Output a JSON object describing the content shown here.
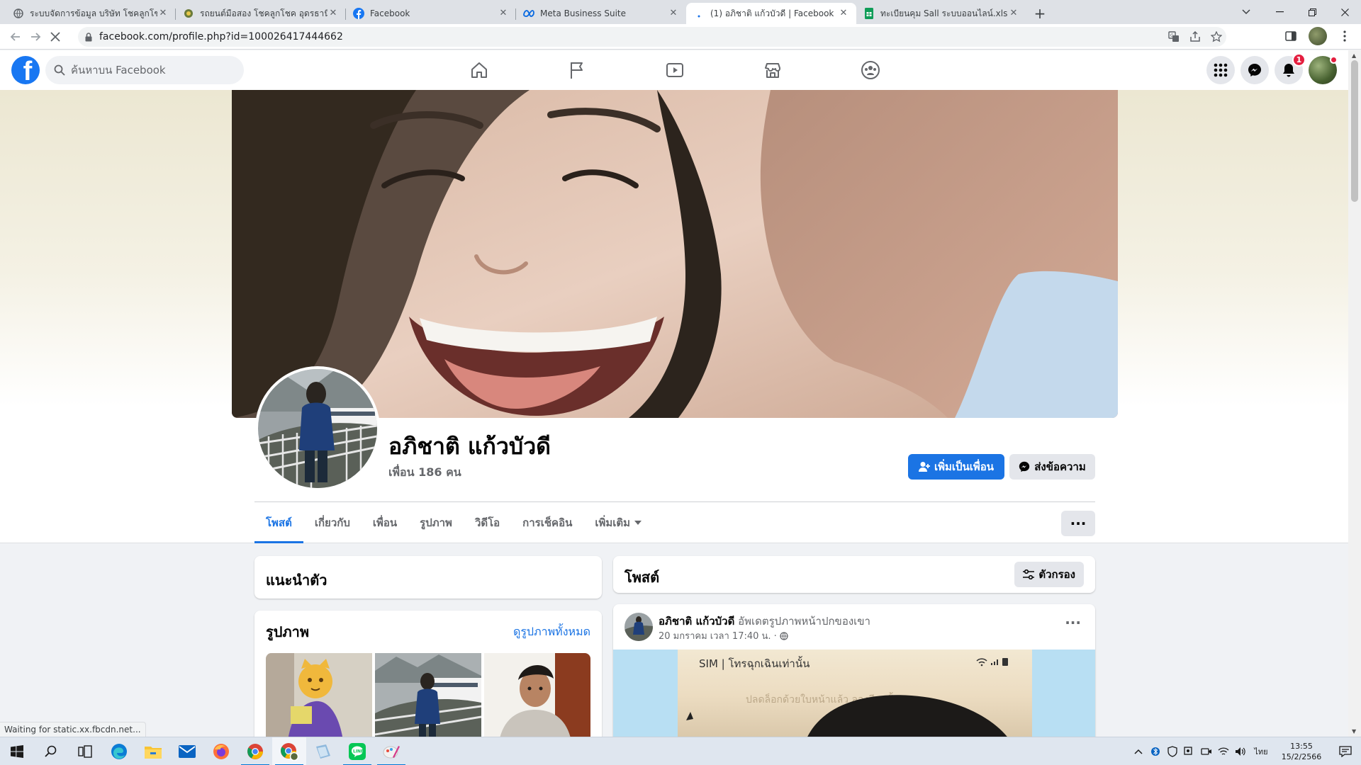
{
  "browser": {
    "tabs": [
      {
        "title": "ระบบจัดการข้อมูล บริษัท โชคลูกโชค จำกัด",
        "icon": "globe"
      },
      {
        "title": "รถยนต์มือสอง โชคลูกโชค อุดรธานี",
        "icon": "site"
      },
      {
        "title": "Facebook",
        "icon": "facebook"
      },
      {
        "title": "Meta Business Suite",
        "icon": "meta"
      },
      {
        "title": "(1) อภิชาติ แก้วบัวดี | Facebook",
        "icon": "loading",
        "active": true
      },
      {
        "title": "ทะเบียนคุม Sall ระบบออนไลน์.xlsx - Google ชีต",
        "icon": "sheets"
      }
    ],
    "new_tab": "+",
    "url": "facebook.com/profile.php?id=100026417444662"
  },
  "facebook": {
    "search_placeholder": "ค้นหาบน Facebook",
    "notification_count": "1",
    "nav_icons": [
      "home-icon",
      "pages-flag-icon",
      "watch-video-icon",
      "marketplace-icon",
      "groups-icon"
    ]
  },
  "profile": {
    "name": "อภิชาติ แก้วบัวดี",
    "friends": "เพื่อน 186 คน",
    "add_friend": "เพิ่มเป็นเพื่อน",
    "message": "ส่งข้อความ",
    "tabs": [
      "โพสต์",
      "เกี่ยวกับ",
      "เพื่อน",
      "รูปภาพ",
      "วิดีโอ",
      "การเช็คอิน",
      "เพิ่มเติม"
    ],
    "more_dots": "···"
  },
  "intro": {
    "title": "แนะนำตัว"
  },
  "photos": {
    "title": "รูปภาพ",
    "see_all": "ดูรูปภาพทั้งหมด"
  },
  "posts": {
    "title": "โพสต์",
    "filter": "ตัวกรอง"
  },
  "post": {
    "author": "อภิชาติ แก้วบัวดี",
    "action": "อัพเดตรูปภาพหน้าปกของเขา",
    "time": "20 มกราคม เวลา 17:40 น. ·",
    "dots": "···",
    "screen_text": "SIM | โทรฉุกเฉินเท่านั้น",
    "screen_sub": "ปลดล็อกด้วยใบหน้าแล้ว ลองอีกครั้ง"
  },
  "status": {
    "text": "Waiting for static.xx.fbcdn.net..."
  },
  "taskbar": {
    "time": "13:55",
    "date": "15/2/2566",
    "lang": "ไทย"
  },
  "colors": {
    "fb_blue": "#1877f2",
    "button_blue": "#1b74e4",
    "page_bg": "#f0f2f5"
  }
}
